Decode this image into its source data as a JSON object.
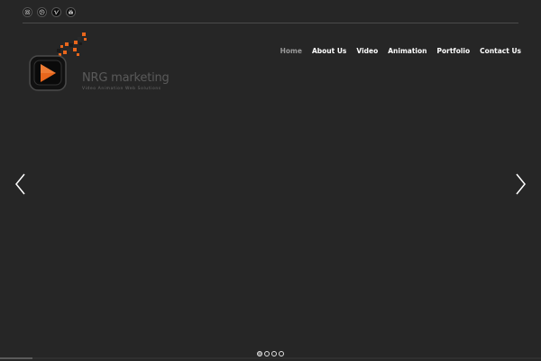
{
  "social": [
    {
      "icon": "instagram-icon"
    },
    {
      "icon": "dribbble-icon"
    },
    {
      "icon": "vimeo-icon"
    },
    {
      "icon": "youtube-icon"
    }
  ],
  "logo": {
    "title": "NRG marketing",
    "tagline": "Video Animation Web Solutions",
    "colors": {
      "accent": "#e8661c",
      "dark": "#111111"
    }
  },
  "nav": {
    "items": [
      {
        "label": "Home",
        "active": true
      },
      {
        "label": "About Us",
        "active": false
      },
      {
        "label": "Video",
        "active": false
      },
      {
        "label": "Animation",
        "active": false
      },
      {
        "label": "Portfolio",
        "active": false
      },
      {
        "label": "Contact Us",
        "active": false
      }
    ]
  },
  "slider": {
    "slide_count": 4,
    "current_slide": 1,
    "progress_fraction": 0.06,
    "prev_icon": "chevron-left-icon",
    "next_icon": "chevron-right-icon"
  },
  "colors": {
    "background": "#262626",
    "nav_active": "#9a9a9a",
    "nav_text": "#ffffff"
  }
}
